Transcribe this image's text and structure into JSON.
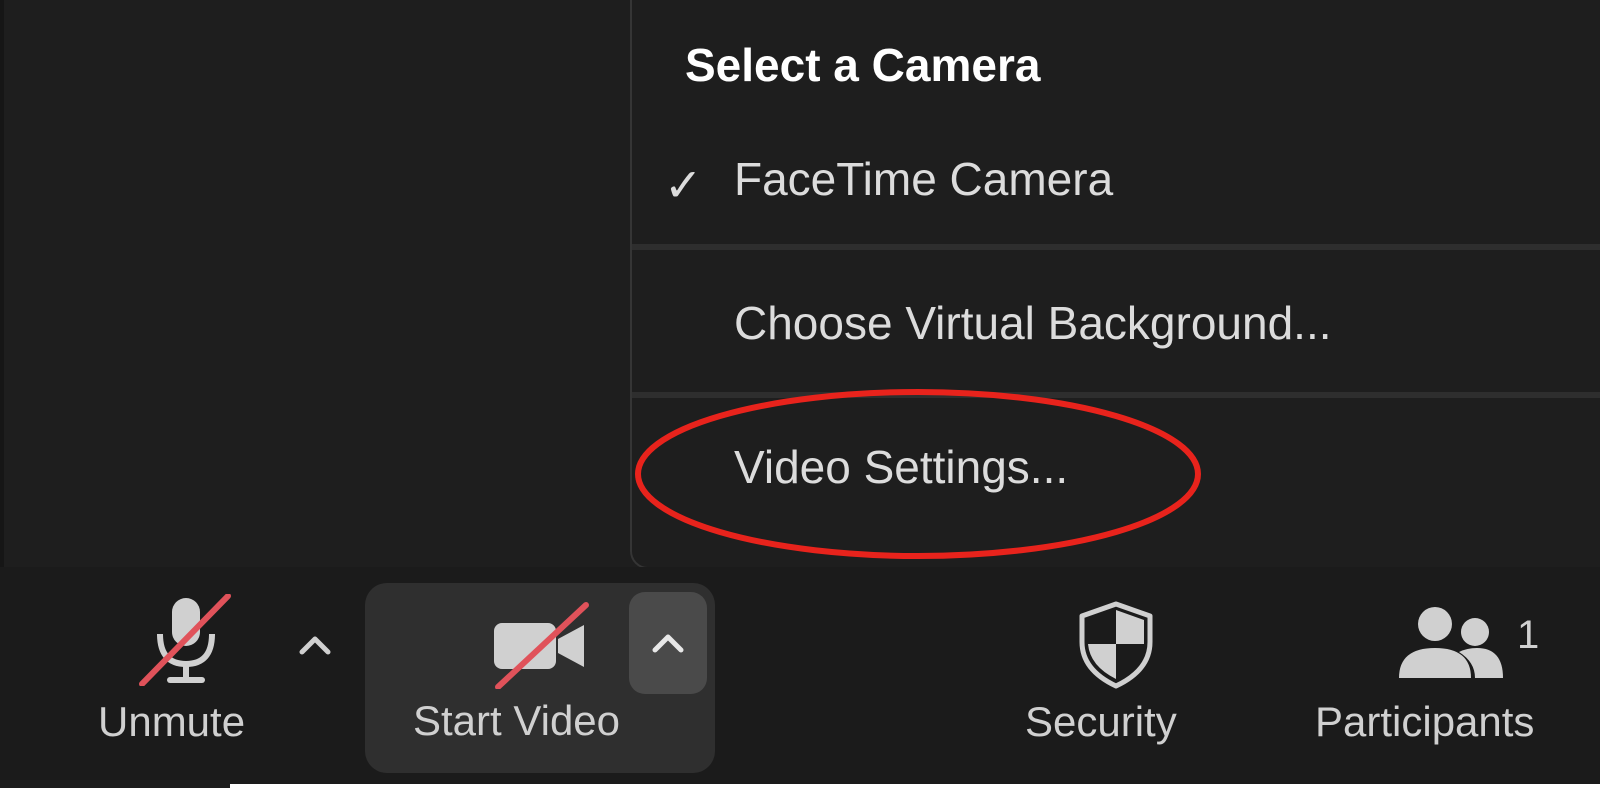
{
  "camera_menu": {
    "heading": "Select a Camera",
    "items": [
      {
        "label": "FaceTime Camera",
        "checked": true,
        "check_glyph": "✓"
      },
      {
        "label": "Choose Virtual Background..."
      },
      {
        "label": "Video Settings..."
      }
    ]
  },
  "toolbar": {
    "unmute_label": "Unmute",
    "start_video_label": "Start Video",
    "security_label": "Security",
    "participants_label": "Participants",
    "participants_count": "1"
  },
  "icons": {
    "mic": "microphone-muted-icon",
    "camera": "video-camera-off-icon",
    "shield": "shield-icon",
    "participants": "participants-icon",
    "chevron": "chevron-up-icon"
  },
  "colors": {
    "background": "#1e1e1e",
    "toolbar": "#1b1b1b",
    "muted_slash": "#e0525a",
    "annotation": "#e8231c",
    "text": "#dcdcdc"
  }
}
